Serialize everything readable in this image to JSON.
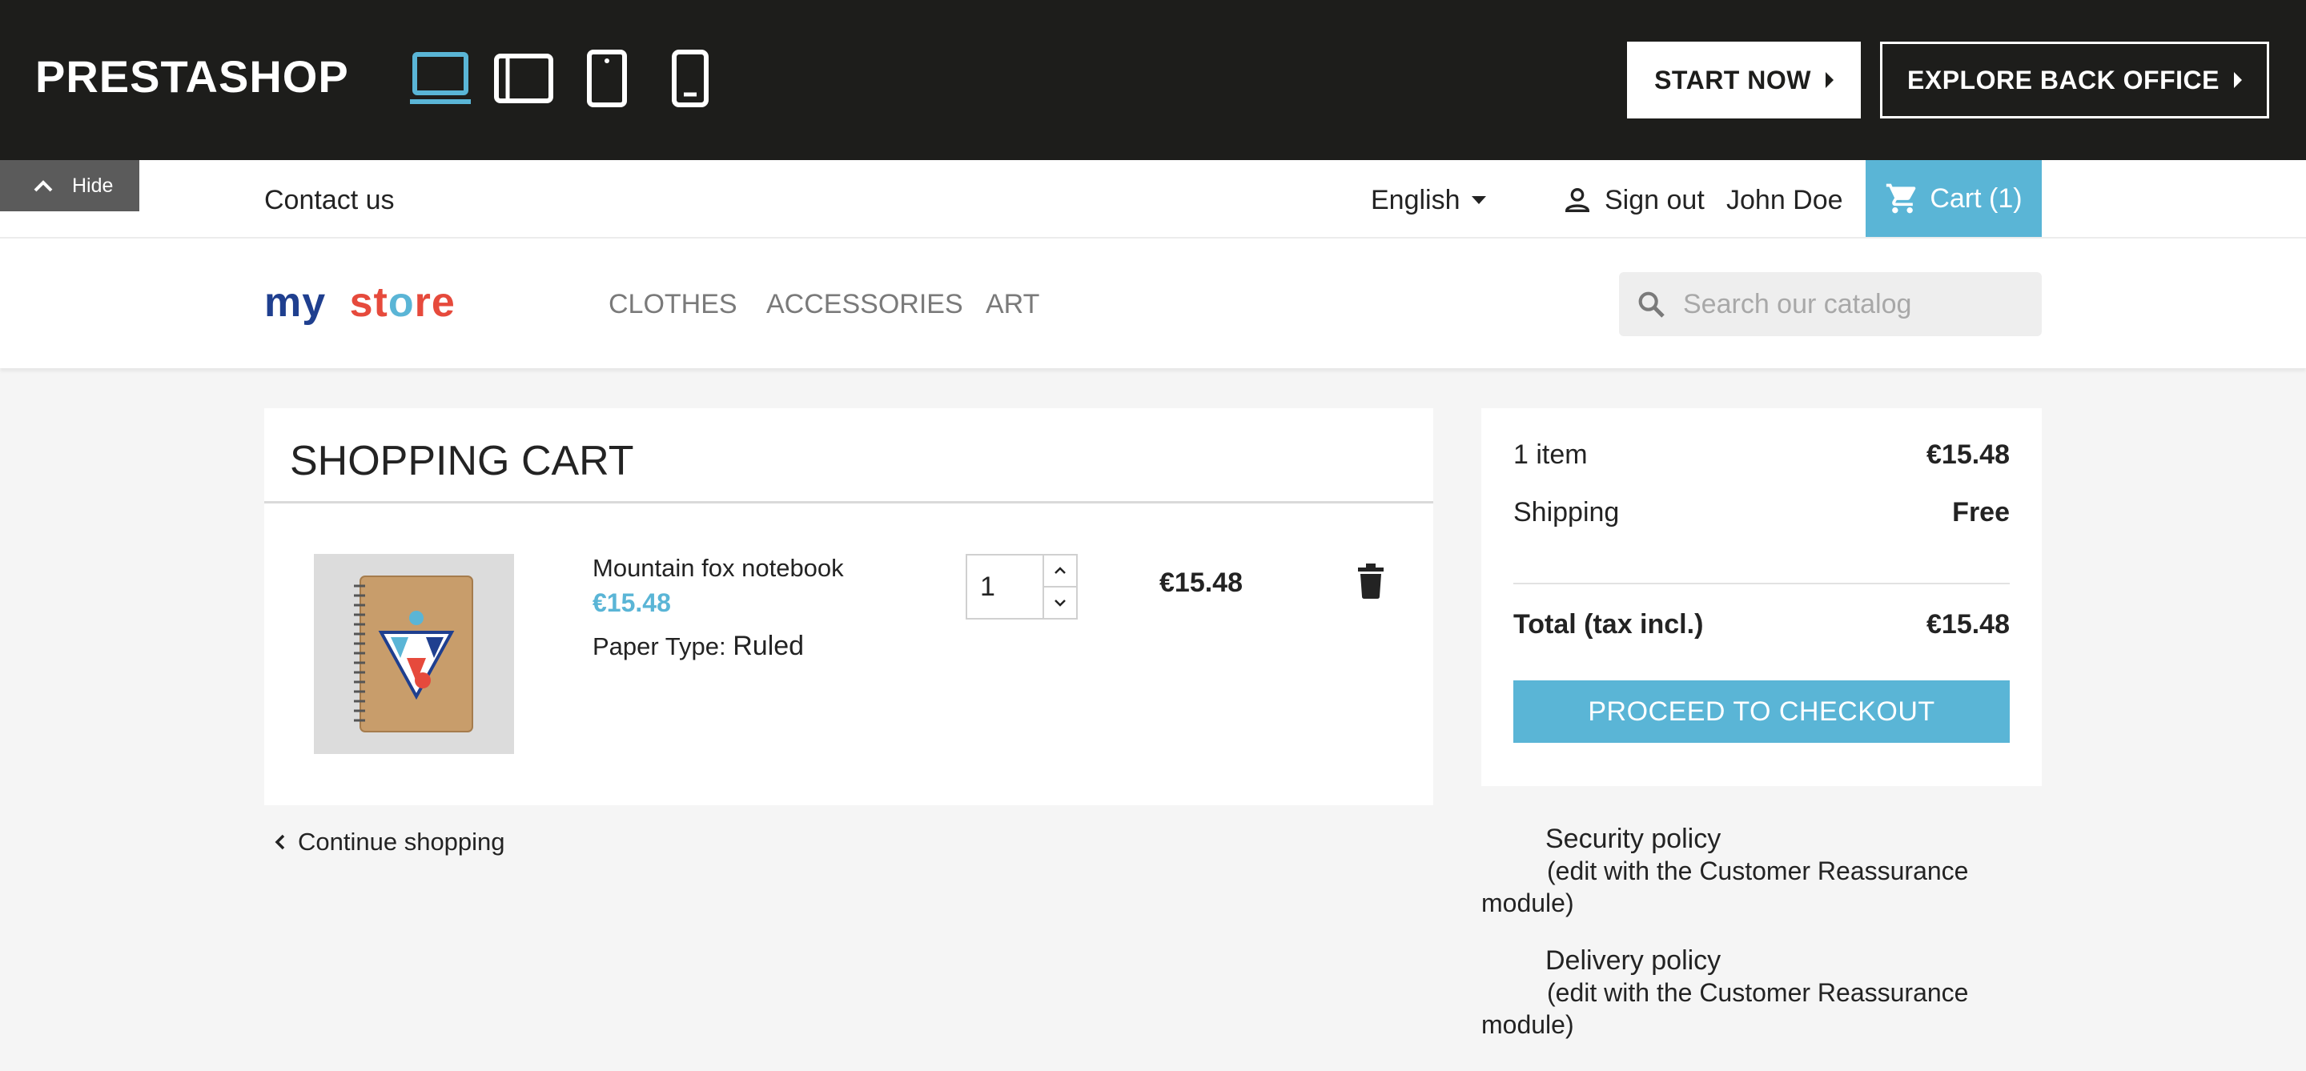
{
  "demo_bar": {
    "logo": "PRESTASHOP",
    "devices": [
      "desktop-icon",
      "tablet-landscape-icon",
      "tablet-portrait-icon",
      "mobile-icon"
    ],
    "active_device": "desktop",
    "start_now": "START NOW",
    "explore": "EXPLORE BACK OFFICE"
  },
  "hide_tab": {
    "label": "Hide"
  },
  "nav": {
    "contact": "Contact us",
    "language": "English",
    "sign_out": "Sign out",
    "user": "John Doe",
    "cart": "Cart (1)"
  },
  "header": {
    "logo_parts": [
      "my",
      "st",
      "o",
      "re"
    ],
    "menu": [
      "CLOTHES",
      "ACCESSORIES",
      "ART"
    ],
    "search_placeholder": "Search our catalog"
  },
  "cart": {
    "title": "SHOPPING CART",
    "product": {
      "name": "Mountain fox notebook",
      "price": "€15.48",
      "attr_label": "Paper Type:",
      "attr_value": "Ruled",
      "quantity": "1",
      "total": "€15.48"
    },
    "continue": "Continue shopping"
  },
  "summary": {
    "items_label": "1 item",
    "items_value": "€15.48",
    "shipping_label": "Shipping",
    "shipping_value": "Free",
    "total_label": "Total (tax incl.)",
    "total_value": "€15.48",
    "checkout": "PROCEED TO CHECKOUT"
  },
  "reassurance": [
    {
      "title": "Security policy",
      "desc": "(edit with the Customer Reassurance module)"
    },
    {
      "title": "Delivery policy",
      "desc": "(edit with the Customer Reassurance module)"
    }
  ],
  "colors": {
    "accent": "#5ab5d6",
    "demo_bar": "#1d1d1b",
    "background": "#f5f5f5"
  }
}
